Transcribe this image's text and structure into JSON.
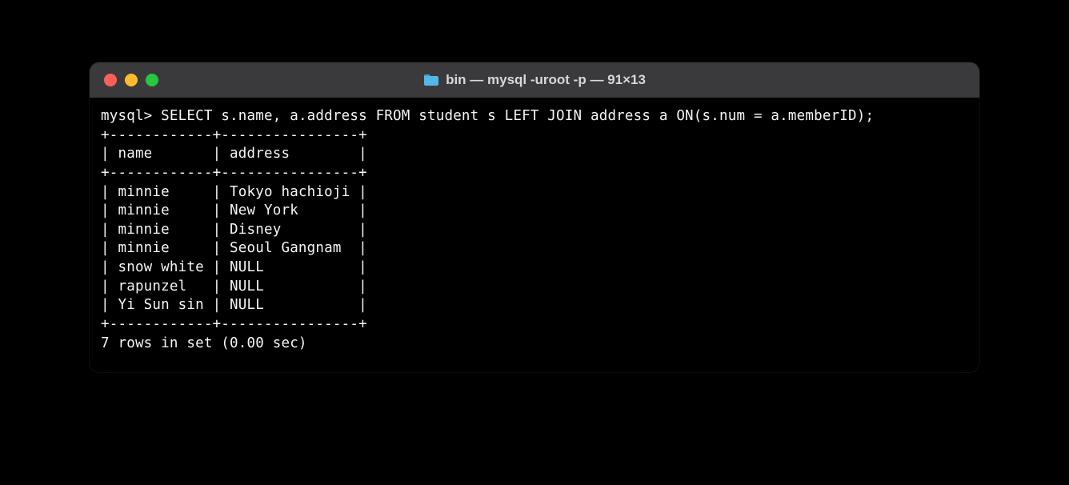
{
  "window": {
    "title": "bin — mysql -uroot -p — 91×13"
  },
  "terminal": {
    "prompt": "mysql>",
    "query": "SELECT s.name, a.address FROM student s LEFT JOIN address a ON(s.num = a.memberID);",
    "columns": [
      "name",
      "address"
    ],
    "rows": [
      {
        "name": "minnie",
        "address": "Tokyo hachioji"
      },
      {
        "name": "minnie",
        "address": "New York"
      },
      {
        "name": "minnie",
        "address": "Disney"
      },
      {
        "name": "minnie",
        "address": "Seoul Gangnam"
      },
      {
        "name": "snow white",
        "address": "NULL"
      },
      {
        "name": "rapunzel",
        "address": "NULL"
      },
      {
        "name": "Yi Sun sin",
        "address": "NULL"
      }
    ],
    "footer": "7 rows in set (0.00 sec)"
  }
}
